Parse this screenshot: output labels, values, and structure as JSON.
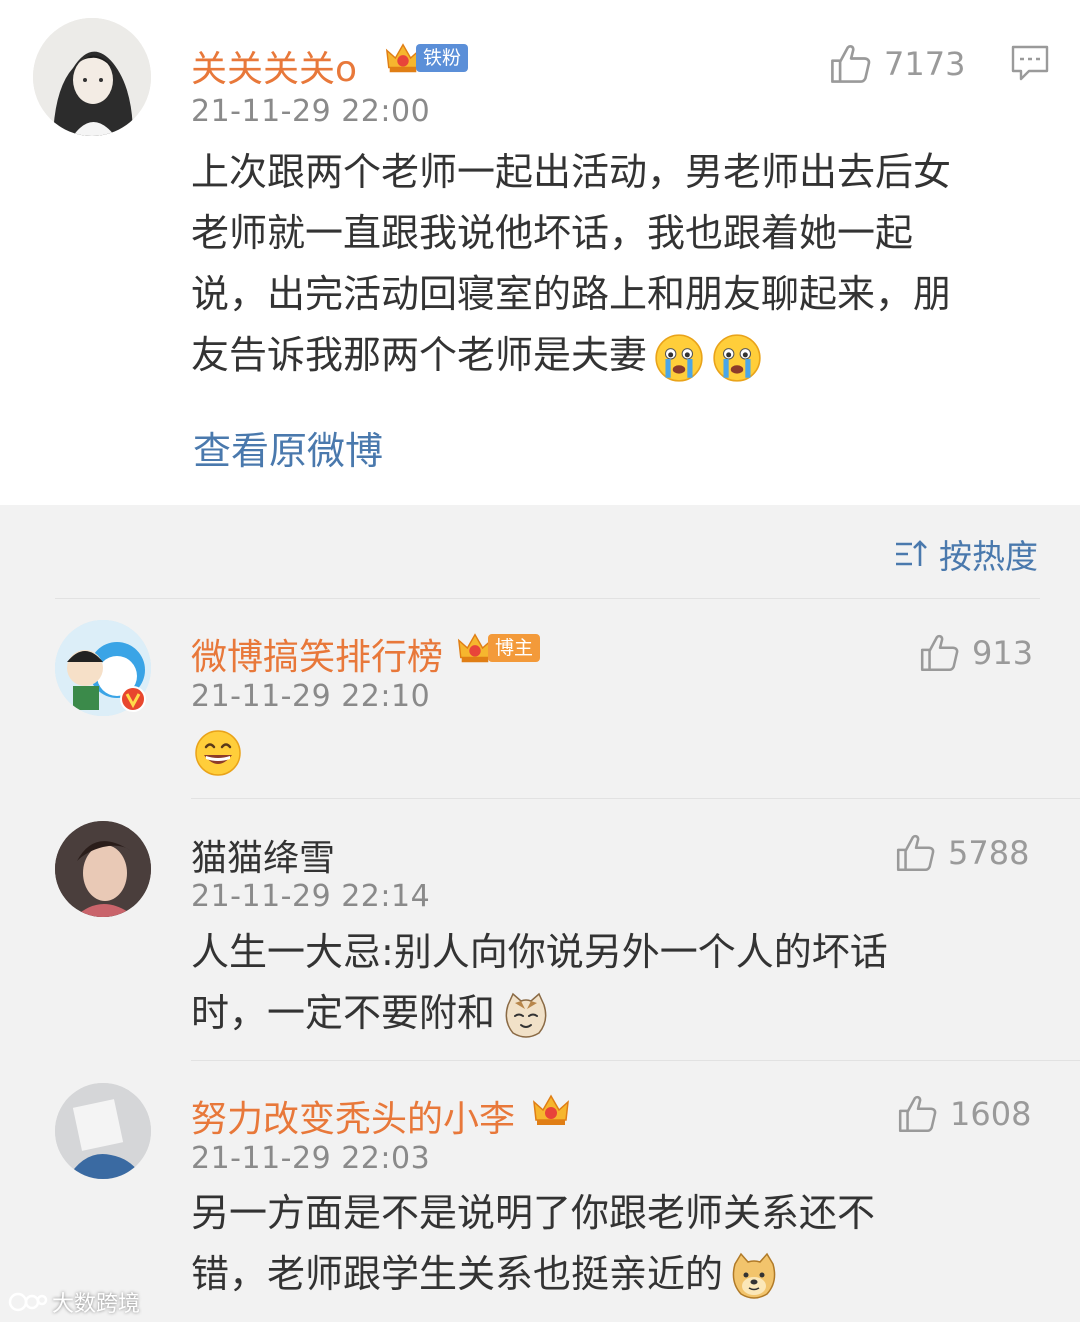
{
  "post": {
    "username": "关关关关o",
    "badge": "铁粉",
    "timestamp": "21-11-29 22:00",
    "likes": "7173",
    "text_lines": [
      "上次跟两个老师一起出活动，男老师出去后女",
      "老师就一直跟我说他坏话，我也跟着她一起",
      "说，出完活动回寝室的路上和朋友聊起来，朋",
      "友告诉我那两个老师是夫妻"
    ],
    "view_original": "查看原微博"
  },
  "sort_label": "按热度",
  "comments": [
    {
      "username": "微博搞笑排行榜",
      "badge": "博主",
      "timestamp": "21-11-29 22:10",
      "likes": "913",
      "text_lines": []
    },
    {
      "username": "猫猫绛雪",
      "badge": "",
      "timestamp": "21-11-29 22:14",
      "likes": "5788",
      "text_lines": [
        "人生一大忌:别人向你说另外一个人的坏话",
        "时，一定不要附和"
      ]
    },
    {
      "username": "努力改变秃头的小李",
      "badge": "",
      "timestamp": "21-11-29 22:03",
      "likes": "1608",
      "text_lines": [
        "另一方面是不是说明了你跟老师关系还不",
        "错，老师跟学生关系也挺亲近的"
      ]
    }
  ],
  "watermark": "大数跨境",
  "icons": {
    "like": "thumbs-up-icon",
    "comment": "comment-icon",
    "sort": "sort-icon",
    "crown": "crown-icon",
    "emoji_cry": "crying-emoji-icon",
    "emoji_grin": "grin-emoji-icon",
    "emoji_cat": "cat-emoji-icon",
    "emoji_doge": "doge-emoji-icon"
  },
  "colors": {
    "username_orange": "#e8783a",
    "link_blue": "#4a79ad",
    "timestamp_gray": "#8a8a8a",
    "badge_blue": "#5b8fd8",
    "badge_orange": "#f39a3a"
  }
}
